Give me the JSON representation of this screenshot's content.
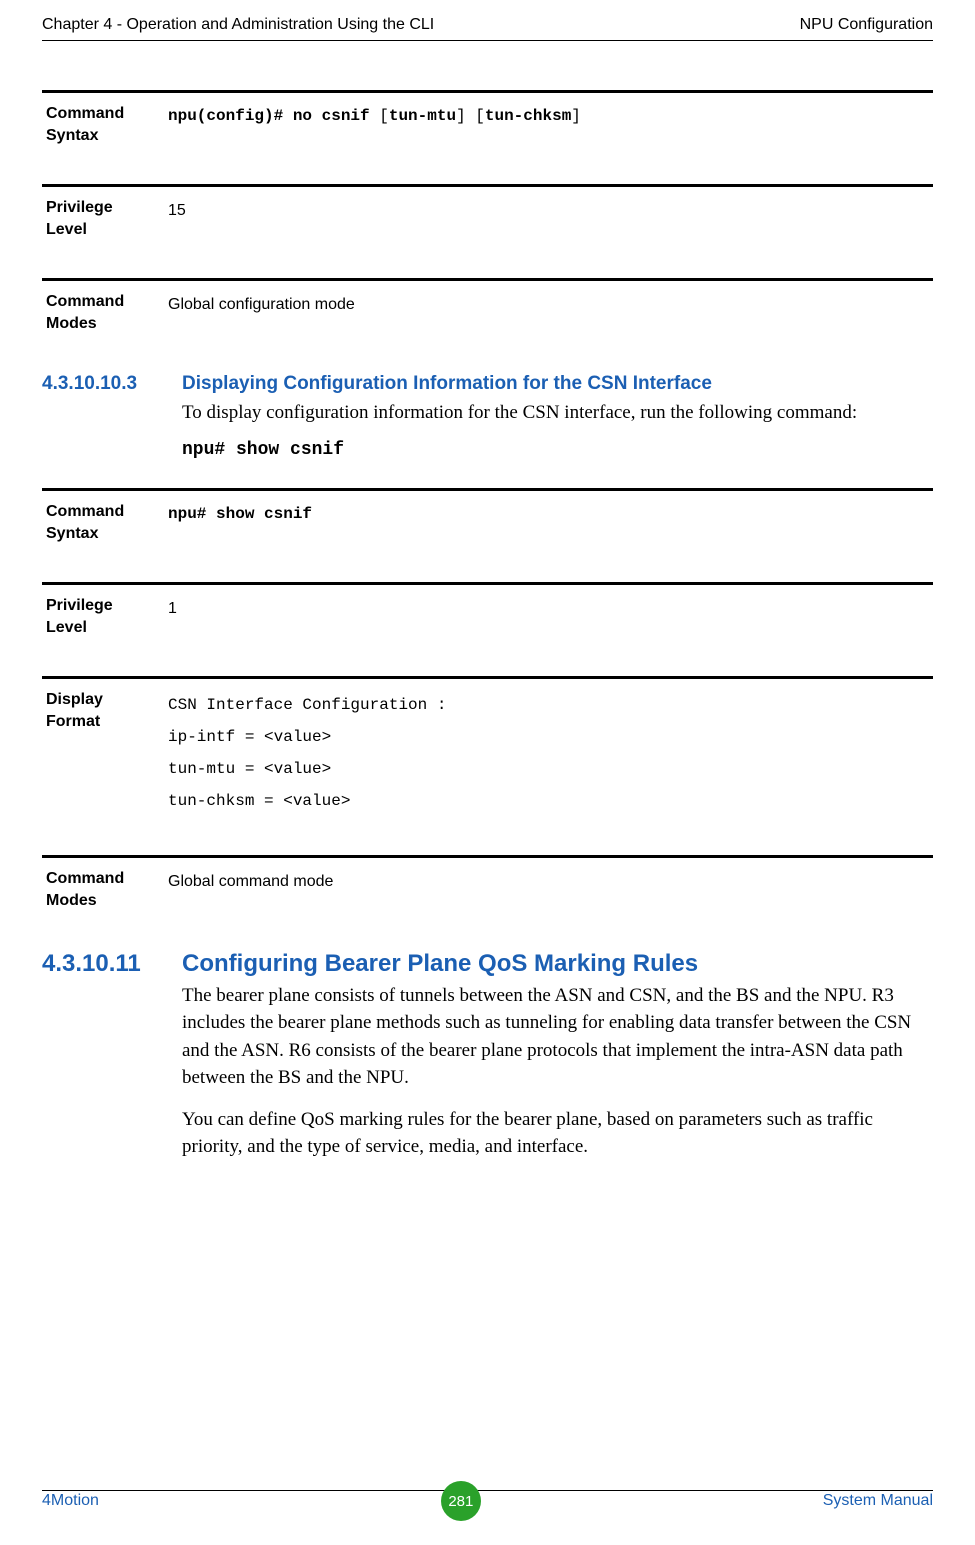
{
  "header": {
    "left": "Chapter 4 - Operation and Administration Using the CLI",
    "right": "NPU Configuration"
  },
  "blocks": {
    "cmd_syntax_label": "Command Syntax",
    "priv_level_label": "Privilege Level",
    "cmd_modes_label": "Command Modes",
    "display_format_label": "Display Format",
    "b1_value_plain1": "npu(config)# no csnif ",
    "b1_value_bold1": "[",
    "b1_value_plain2": "tun-mtu",
    "b1_value_bold2": "] [",
    "b1_value_plain3": "tun-chksm",
    "b1_value_bold3": "]",
    "b2_value": "15",
    "b3_value": "Global configuration mode",
    "b4_value": "npu# show csnif",
    "b5_value": "1",
    "b6_line1": "CSN Interface Configuration :",
    "b6_line2": "ip-intf = <value>",
    "b6_line3": "tun-mtu = <value>",
    "b6_line4": "tun-chksm = <value>",
    "b7_value": "Global command mode"
  },
  "sec1": {
    "num": "4.3.10.10.3",
    "title": "Displaying Configuration Information for the CSN Interface",
    "para": "To display configuration information for the CSN interface, run the following command:",
    "cmd": "npu# show csnif"
  },
  "sec2": {
    "num": "4.3.10.11",
    "title": "Configuring Bearer Plane QoS Marking Rules",
    "p1": "The bearer plane consists of tunnels between the ASN and CSN, and the BS and the NPU. R3 includes the bearer plane methods such as tunneling for enabling data transfer between the CSN and the ASN. R6 consists of the bearer plane protocols that implement the intra-ASN data path between the BS and the NPU.",
    "p2": "You can define QoS marking rules for the bearer plane, based on parameters such as traffic priority, and the type of service, media, and interface."
  },
  "footer": {
    "left": "4Motion",
    "page": "281",
    "right": "System Manual"
  }
}
